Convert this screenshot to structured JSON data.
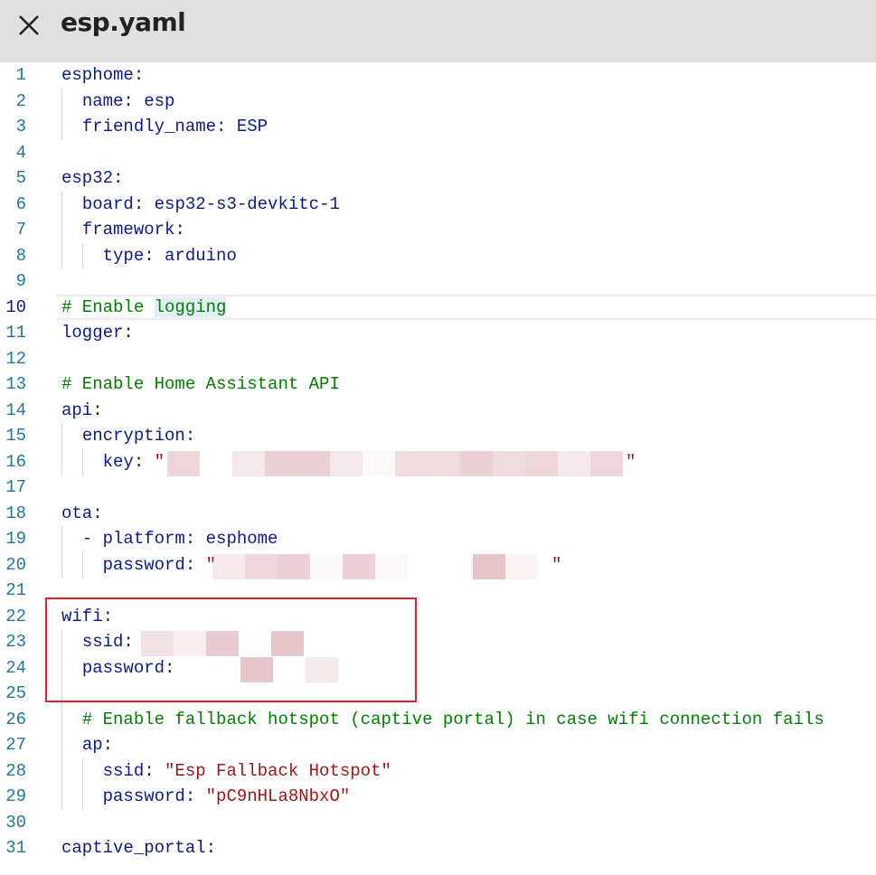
{
  "header": {
    "title": "esp.yaml",
    "close_icon": "close-icon"
  },
  "editor": {
    "current_line": 10,
    "lines": [
      {
        "n": "1",
        "t": [
          [
            "k",
            "esphome"
          ],
          [
            "p",
            ":"
          ]
        ]
      },
      {
        "n": "2",
        "t": [
          [
            "p",
            "  "
          ],
          [
            "k",
            "name"
          ],
          [
            "p",
            ": "
          ],
          [
            "v",
            "esp"
          ]
        ]
      },
      {
        "n": "3",
        "t": [
          [
            "p",
            "  "
          ],
          [
            "k",
            "friendly_name"
          ],
          [
            "p",
            ": "
          ],
          [
            "v",
            "ESP"
          ]
        ]
      },
      {
        "n": "4",
        "t": []
      },
      {
        "n": "5",
        "t": [
          [
            "k",
            "esp32"
          ],
          [
            "p",
            ":"
          ]
        ]
      },
      {
        "n": "6",
        "t": [
          [
            "p",
            "  "
          ],
          [
            "k",
            "board"
          ],
          [
            "p",
            ": "
          ],
          [
            "v",
            "esp32-s3-devkitc-1"
          ]
        ]
      },
      {
        "n": "7",
        "t": [
          [
            "p",
            "  "
          ],
          [
            "k",
            "framework"
          ],
          [
            "p",
            ":"
          ]
        ]
      },
      {
        "n": "8",
        "t": [
          [
            "p",
            "    "
          ],
          [
            "k",
            "type"
          ],
          [
            "p",
            ": "
          ],
          [
            "v",
            "arduino"
          ]
        ]
      },
      {
        "n": "9",
        "t": []
      },
      {
        "n": "10",
        "t": [
          [
            "c",
            "# Enable "
          ],
          [
            "c hl",
            "logging"
          ]
        ]
      },
      {
        "n": "11",
        "t": [
          [
            "k",
            "logger"
          ],
          [
            "p",
            ":"
          ]
        ]
      },
      {
        "n": "12",
        "t": []
      },
      {
        "n": "13",
        "t": [
          [
            "c",
            "# Enable Home Assistant API"
          ]
        ]
      },
      {
        "n": "14",
        "t": [
          [
            "k",
            "api"
          ],
          [
            "p",
            ":"
          ]
        ]
      },
      {
        "n": "15",
        "t": [
          [
            "p",
            "  "
          ],
          [
            "k",
            "encryption"
          ],
          [
            "p",
            ":"
          ]
        ]
      },
      {
        "n": "16",
        "t": [
          [
            "p",
            "    "
          ],
          [
            "k",
            "key"
          ],
          [
            "p",
            ": "
          ],
          [
            "s",
            "\""
          ]
        ]
      },
      {
        "n": "17",
        "t": []
      },
      {
        "n": "18",
        "t": [
          [
            "k",
            "ota"
          ],
          [
            "p",
            ":"
          ]
        ]
      },
      {
        "n": "19",
        "t": [
          [
            "p",
            "  - "
          ],
          [
            "k",
            "platform"
          ],
          [
            "p",
            ": "
          ],
          [
            "v",
            "esphome"
          ]
        ]
      },
      {
        "n": "20",
        "t": [
          [
            "p",
            "    "
          ],
          [
            "k",
            "password"
          ],
          [
            "p",
            ": "
          ],
          [
            "s",
            "\""
          ]
        ]
      },
      {
        "n": "21",
        "t": []
      },
      {
        "n": "22",
        "t": [
          [
            "k",
            "wifi"
          ],
          [
            "p",
            ":"
          ]
        ]
      },
      {
        "n": "23",
        "t": [
          [
            "p",
            "  "
          ],
          [
            "k",
            "ssid"
          ],
          [
            "p",
            ":"
          ]
        ]
      },
      {
        "n": "24",
        "t": [
          [
            "p",
            "  "
          ],
          [
            "k",
            "password"
          ],
          [
            "p",
            ":"
          ]
        ]
      },
      {
        "n": "25",
        "t": []
      },
      {
        "n": "26",
        "t": [
          [
            "p",
            "  "
          ],
          [
            "c",
            "# Enable fallback hotspot (captive portal) in case wifi connection fails"
          ]
        ]
      },
      {
        "n": "27",
        "t": [
          [
            "p",
            "  "
          ],
          [
            "k",
            "ap"
          ],
          [
            "p",
            ":"
          ]
        ]
      },
      {
        "n": "28",
        "t": [
          [
            "p",
            "    "
          ],
          [
            "k",
            "ssid"
          ],
          [
            "p",
            ": "
          ],
          [
            "s",
            "\"Esp Fallback Hotspot\""
          ]
        ]
      },
      {
        "n": "29",
        "t": [
          [
            "p",
            "    "
          ],
          [
            "k",
            "password"
          ],
          [
            "p",
            ": "
          ],
          [
            "s",
            "\"pC9nHLa8NbxO\""
          ]
        ]
      },
      {
        "n": "30",
        "t": []
      },
      {
        "n": "31",
        "t": [
          [
            "k",
            "captive_portal"
          ],
          [
            "p",
            ":"
          ]
        ]
      }
    ]
  },
  "colors": {
    "highlight_box": "#e0202a",
    "redaction": "#e8c8cc"
  }
}
